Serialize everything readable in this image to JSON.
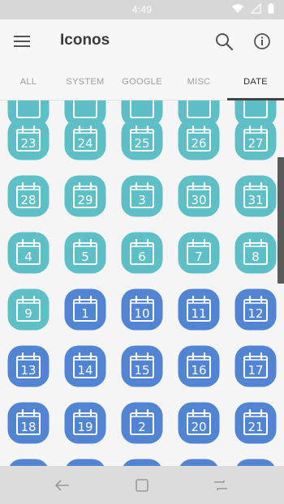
{
  "status_bar": {
    "time": "4:49",
    "icons": [
      "wifi-icon",
      "signal-icon",
      "battery-icon"
    ]
  },
  "app_bar": {
    "title": "Iconos",
    "icons": [
      "menu-icon",
      "search-icon",
      "info-icon"
    ]
  },
  "tabs": [
    {
      "label": "ALL",
      "active": false
    },
    {
      "label": "SYSTEM",
      "active": false
    },
    {
      "label": "GOOGLE",
      "active": false
    },
    {
      "label": "MISC",
      "active": false
    },
    {
      "label": "DATE",
      "active": true
    }
  ],
  "colors": {
    "teal": "#5fbfc6",
    "blue": "#5185d3",
    "teal_dark": "#4fb0b8",
    "blue_dark": "#426fbd"
  },
  "icon_rows": [
    [
      {
        "label": "",
        "color": "teal"
      },
      {
        "label": "",
        "color": "teal"
      },
      {
        "label": "",
        "color": "teal"
      },
      {
        "label": "",
        "color": "teal"
      },
      {
        "label": "",
        "color": "teal"
      }
    ],
    [
      {
        "label": "23",
        "color": "teal"
      },
      {
        "label": "24",
        "color": "teal"
      },
      {
        "label": "25",
        "color": "teal"
      },
      {
        "label": "26",
        "color": "teal"
      },
      {
        "label": "27",
        "color": "teal"
      }
    ],
    [
      {
        "label": "28",
        "color": "teal"
      },
      {
        "label": "29",
        "color": "teal"
      },
      {
        "label": "3",
        "color": "teal"
      },
      {
        "label": "30",
        "color": "teal"
      },
      {
        "label": "31",
        "color": "teal"
      }
    ],
    [
      {
        "label": "4",
        "color": "teal"
      },
      {
        "label": "5",
        "color": "teal"
      },
      {
        "label": "6",
        "color": "teal"
      },
      {
        "label": "7",
        "color": "teal"
      },
      {
        "label": "8",
        "color": "teal"
      }
    ],
    [
      {
        "label": "9",
        "color": "teal"
      },
      {
        "label": "1",
        "color": "blue"
      },
      {
        "label": "10",
        "color": "blue"
      },
      {
        "label": "11",
        "color": "blue"
      },
      {
        "label": "12",
        "color": "blue"
      }
    ],
    [
      {
        "label": "13",
        "color": "blue"
      },
      {
        "label": "14",
        "color": "blue"
      },
      {
        "label": "15",
        "color": "blue"
      },
      {
        "label": "16",
        "color": "blue"
      },
      {
        "label": "17",
        "color": "blue"
      }
    ],
    [
      {
        "label": "18",
        "color": "blue"
      },
      {
        "label": "19",
        "color": "blue"
      },
      {
        "label": "2",
        "color": "blue"
      },
      {
        "label": "20",
        "color": "blue"
      },
      {
        "label": "21",
        "color": "blue"
      }
    ],
    [
      {
        "label": "",
        "color": "blue"
      },
      {
        "label": "",
        "color": "blue"
      },
      {
        "label": "",
        "color": "blue"
      },
      {
        "label": "",
        "color": "blue"
      },
      {
        "label": "",
        "color": "blue"
      }
    ]
  ],
  "nav_bar": {
    "icons": [
      "back-icon",
      "home-icon",
      "recents-icon"
    ]
  }
}
